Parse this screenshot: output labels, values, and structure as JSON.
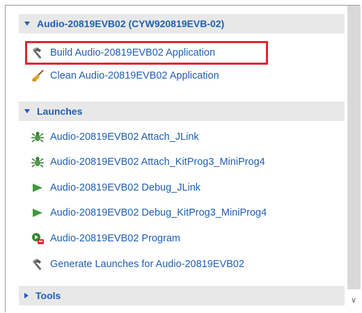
{
  "sections": {
    "audio": {
      "title": "Audio-20819EVB02 (CYW920819EVB-02)",
      "items": [
        {
          "label": "Build Audio-20819EVB02 Application",
          "icon": "hammer-icon"
        },
        {
          "label": "Clean Audio-20819EVB02 Application",
          "icon": "broom-icon"
        }
      ]
    },
    "launches": {
      "title": "Launches",
      "items": [
        {
          "label": "Audio-20819EVB02 Attach_JLink",
          "icon": "bug-icon"
        },
        {
          "label": "Audio-20819EVB02 Attach_KitProg3_MiniProg4",
          "icon": "bug-icon"
        },
        {
          "label": "Audio-20819EVB02 Debug_JLink",
          "icon": "play-icon"
        },
        {
          "label": "Audio-20819EVB02 Debug_KitProg3_MiniProg4",
          "icon": "play-icon"
        },
        {
          "label": "Audio-20819EVB02 Program",
          "icon": "program-icon"
        },
        {
          "label": "Generate Launches for Audio-20819EVB02",
          "icon": "hammer-icon"
        }
      ]
    },
    "tools": {
      "title": "Tools"
    }
  },
  "colors": {
    "link": "#1f5fb1",
    "header_bg": "#e8e8e8",
    "highlight": "#e0242f"
  }
}
